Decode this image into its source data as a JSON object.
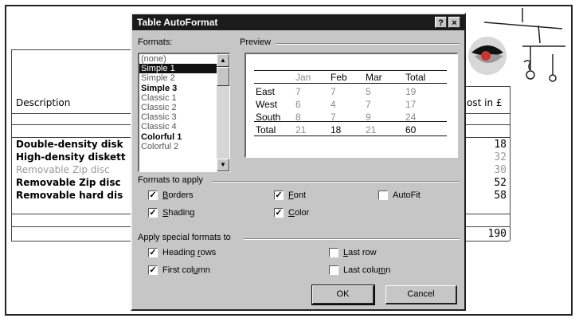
{
  "dialog": {
    "title": "Table AutoFormat",
    "help_btn": "?",
    "close_btn": "×",
    "formats_label": "Formats:",
    "preview_label": "Preview",
    "formats": [
      {
        "label": "(none)",
        "state": "normal"
      },
      {
        "label": "Simple 1",
        "state": "selected"
      },
      {
        "label": "Simple 2",
        "state": "normal"
      },
      {
        "label": "Simple 3",
        "state": "bold"
      },
      {
        "label": "Classic 1",
        "state": "normal"
      },
      {
        "label": "Classic 2",
        "state": "normal"
      },
      {
        "label": "Classic 3",
        "state": "normal"
      },
      {
        "label": "Classic 4",
        "state": "normal"
      },
      {
        "label": "Colorful 1",
        "state": "bold"
      },
      {
        "label": "Colorful 2",
        "state": "normal"
      }
    ],
    "preview": {
      "header": [
        "Jan",
        "Feb",
        "Mar",
        "Total"
      ],
      "rows": [
        {
          "label": "East",
          "values": [
            "7",
            "7",
            "5",
            "19"
          ]
        },
        {
          "label": "West",
          "values": [
            "6",
            "4",
            "7",
            "17"
          ]
        },
        {
          "label": "South",
          "values": [
            "8",
            "7",
            "9",
            "24"
          ]
        },
        {
          "label": "Total",
          "values": [
            "21",
            "18",
            "21",
            "60"
          ]
        }
      ]
    },
    "apply_group_label": "Formats to apply",
    "apply": {
      "borders": {
        "label": "Borders",
        "checked": true
      },
      "font": {
        "label": "Font",
        "checked": true
      },
      "autofit": {
        "label": "AutoFit",
        "checked": false
      },
      "shading": {
        "label": "Shading",
        "checked": true
      },
      "color": {
        "label": "Color",
        "checked": true
      }
    },
    "special_group_label": "Apply special formats to",
    "special": {
      "heading_rows": {
        "label": "Heading rows",
        "checked": true
      },
      "last_row": {
        "label": "Last row",
        "checked": false
      },
      "first_column": {
        "label": "First column",
        "checked": true
      },
      "last_column": {
        "label": "Last column",
        "checked": false
      }
    },
    "ok_label": "OK",
    "cancel_label": "Cancel",
    "check_mark": "✓"
  },
  "document": {
    "header_left": "Description",
    "header_right": "ost in £",
    "rows": [
      {
        "text": "Double-density disk",
        "style": "bold",
        "value": "18",
        "value_style": "normal"
      },
      {
        "text": "High-density diskett",
        "style": "bold",
        "value": "32",
        "value_style": "gray"
      },
      {
        "text": "Removable Zip disc",
        "style": "gray",
        "value": "30",
        "value_style": "gray"
      },
      {
        "text": "Removable Zip disc",
        "style": "bold",
        "value": "52",
        "value_style": "normal"
      },
      {
        "text": "Removable hard dis",
        "style": "bold",
        "value": "58",
        "value_style": "normal"
      }
    ],
    "total_value": "190"
  }
}
